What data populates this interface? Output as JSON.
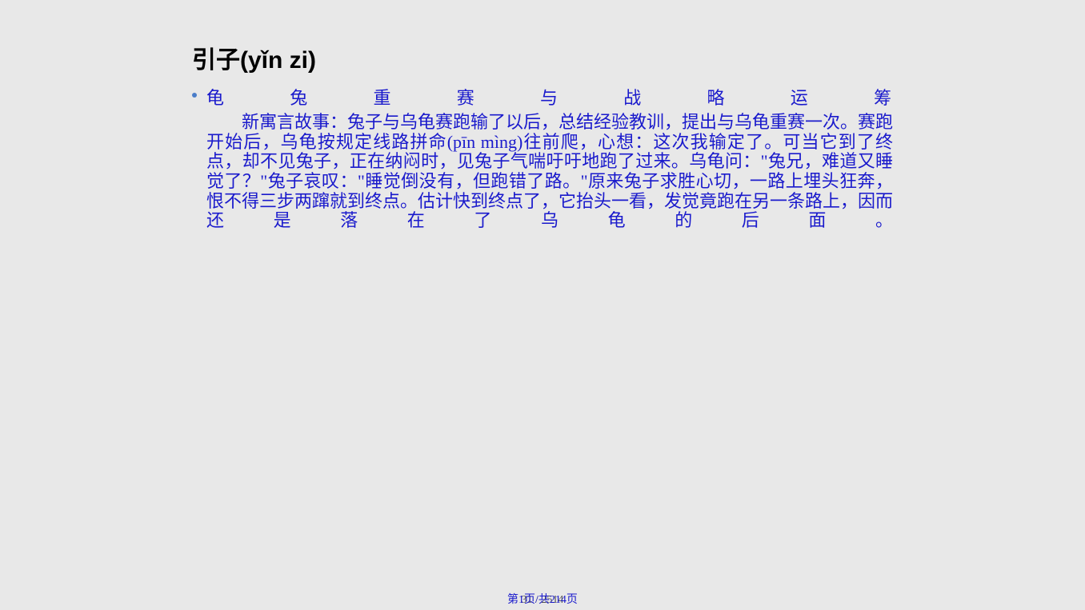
{
  "title": "引子(yǐn zi)",
  "subtitle": "龟兔重赛与战略运筹",
  "body": "新寓言故事：兔子与乌龟赛跑输了以后，总结经验教训，提出与乌龟重赛一次。赛跑开始后，乌龟按规定线路拼命(pīn mìng)往前爬，心想：这次我输定了。可当它到了终点，却不见兔子，正在纳闷时，见兔子气喘吁吁地跑了过来。乌龟问：\"兔兄，难道又睡觉了？\"兔子哀叹：\"睡觉倒没有，但跑错了路。\"原来兔子求胜心切，一路上埋头狂奔，恨不得三步两蹿就到终点。估计快到终点了，它抬头一看，发觉竟跑在另一条路上，因而还是落在了乌龟的后面。",
  "footer_back": "31 / 2514",
  "footer_front": "第1页/共214页"
}
